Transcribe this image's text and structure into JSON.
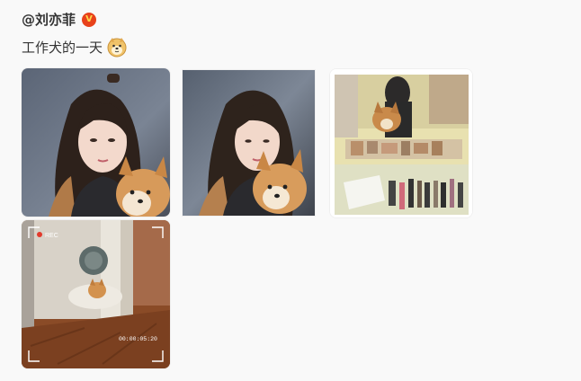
{
  "post": {
    "username": "@刘亦菲",
    "verified_badge": "V",
    "text": "工作犬的一天",
    "text_emoji": "doge-emoji-icon"
  },
  "photos": [
    {
      "name": "selfie-with-dog-1"
    },
    {
      "name": "selfie-with-dog-2"
    },
    {
      "name": "dog-at-makeup-table"
    },
    {
      "name": "dog-in-camera-viewfinder",
      "overlay": {
        "rec": "REC",
        "time": "00:00:05:20"
      }
    }
  ],
  "colors": {
    "background": "#f9f9f9",
    "verified": "#e8421b",
    "rec": "#e23a2c"
  }
}
